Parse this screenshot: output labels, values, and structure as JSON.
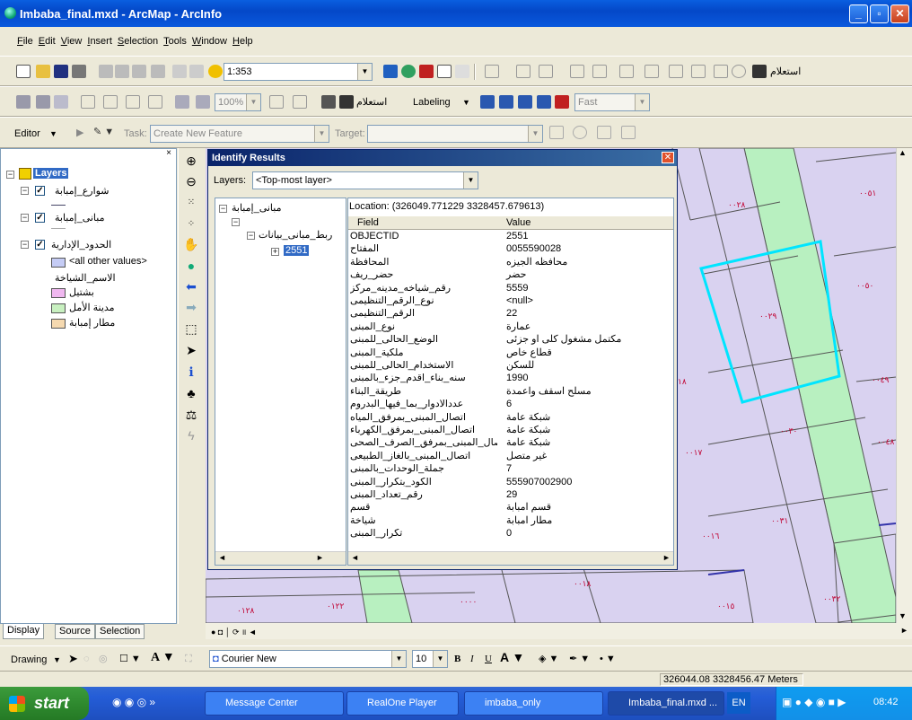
{
  "window": {
    "title": "Imbaba_final.mxd - ArcMap - ArcInfo"
  },
  "menu": [
    "File",
    "Edit",
    "View",
    "Insert",
    "Selection",
    "Tools",
    "Window",
    "Help"
  ],
  "standard": {
    "scale": "1:353",
    "estilam": "استعلام"
  },
  "toolbar2": {
    "zoom": "100%",
    "estilam": "استعلام",
    "labeling": "Labeling",
    "fast": "Fast"
  },
  "editor": {
    "label": "Editor",
    "task_label": "Task:",
    "task_value": "Create New Feature",
    "target_label": "Target:"
  },
  "toc": {
    "root": "Layers",
    "l1": "شوارع_إمبابة",
    "l2": "مبانى_إمبابة",
    "l3": "الحدود_الإدارية",
    "all_other": "<all other values>",
    "field_name": "الاسم_الشياخة",
    "c1": "بشتيل",
    "c2": "مدينة الأمل",
    "c3": "مطار إمبابة"
  },
  "tabs": [
    "Display",
    "Source",
    "Selection"
  ],
  "identify": {
    "title": "Identify Results",
    "layers_label": "Layers:",
    "layers_value": "<Top-most layer>",
    "tree_root": "مبانى_إمبابة",
    "tree_child": "ربط_مبانى_بيانات",
    "tree_id": "2551",
    "location": "Location: (326049.771229 3328457.679613)",
    "col_field": "Field",
    "col_value": "Value",
    "rows": [
      [
        "OBJECTID",
        "2551"
      ],
      [
        "المفتاح",
        "0055590028"
      ],
      [
        "المحافظة",
        "محافظه الجيزه"
      ],
      [
        "حضر_ريف",
        "حضر"
      ],
      [
        "رقم_شياخه_مدينه_مركز",
        "5559"
      ],
      [
        "نوع_الرقم_التنظيمى",
        "<null>"
      ],
      [
        "الرقم_التنظيمى",
        "22"
      ],
      [
        "نوع_المبنى",
        "عمارة"
      ],
      [
        "الوضع_الحالى_للمبنى",
        "مكتمل مشغول كلى او جزئى"
      ],
      [
        "ملكية_المبنى",
        "قطاع خاص"
      ],
      [
        "الاستخدام_الحالى_للمبنى",
        "للسكن"
      ],
      [
        "سنه_بناء_اقدم_جزء_بالمبنى",
        "1990"
      ],
      [
        "طريقة_البناء",
        "مسلح اسقف واعمدة"
      ],
      [
        "عددالادوار_بما_فيها_البدروم",
        "6"
      ],
      [
        "اتصال_المبنى_بمرفق_المياه",
        "شبكة عامة"
      ],
      [
        "اتصال_المبنى_بمرفق_الكهرباء",
        "شبكة عامة"
      ],
      [
        "اتصال_المبنى_بمرفق_الصرف_الصحى",
        "شبكة عامة"
      ],
      [
        "اتصال_المبنى_بالغاز_الطبيعى",
        "غير متصل"
      ],
      [
        "جملة_الوحدات_بالمبنى",
        "7"
      ],
      [
        "الكود_بتكرار_المبنى",
        "555907002900"
      ],
      [
        "رقم_تعداد_المبنى",
        "29"
      ],
      [
        "قسم",
        "قسم امبابة"
      ],
      [
        "شياخة",
        "مطار امبابة"
      ],
      [
        "تكرار_المبنى",
        "0"
      ]
    ]
  },
  "map_labels": [
    "٠٠٥١",
    "٠٠٢٨",
    "٠٠٥٠",
    "٠٠٢٩",
    "٠٠٤٩",
    "١٨",
    "٠٠٣٠",
    "٠٠٤٨",
    "٠٠١٧",
    "٠٠٣١",
    "٠٠١٦",
    "٠٠١٨",
    "٠٠٠٠",
    "٠١٢٨",
    "٠١٢٢",
    "٠٠١٥",
    "٠٠٣٢"
  ],
  "drawing": {
    "label": "Drawing",
    "font": "Courier New",
    "size": "10"
  },
  "status": {
    "coords": "326044.08  3328456.47 Meters"
  },
  "taskbar": {
    "start": "start",
    "items": [
      "Message Center",
      "RealOne Player",
      "imbaba_only",
      "Imbaba_final.mxd ..."
    ],
    "lang": "EN",
    "time": "08:42"
  },
  "colors": {
    "title_blue": "#0a58dd",
    "map_bg": "#d9d2f0",
    "street": "#b8f0c0",
    "highlight": "#00e5ff",
    "label_red": "#c00030",
    "c1": "#f0b8f0",
    "c2": "#c8f0c0",
    "c3": "#f5d9b0",
    "all_other": "#c5ccf5"
  }
}
